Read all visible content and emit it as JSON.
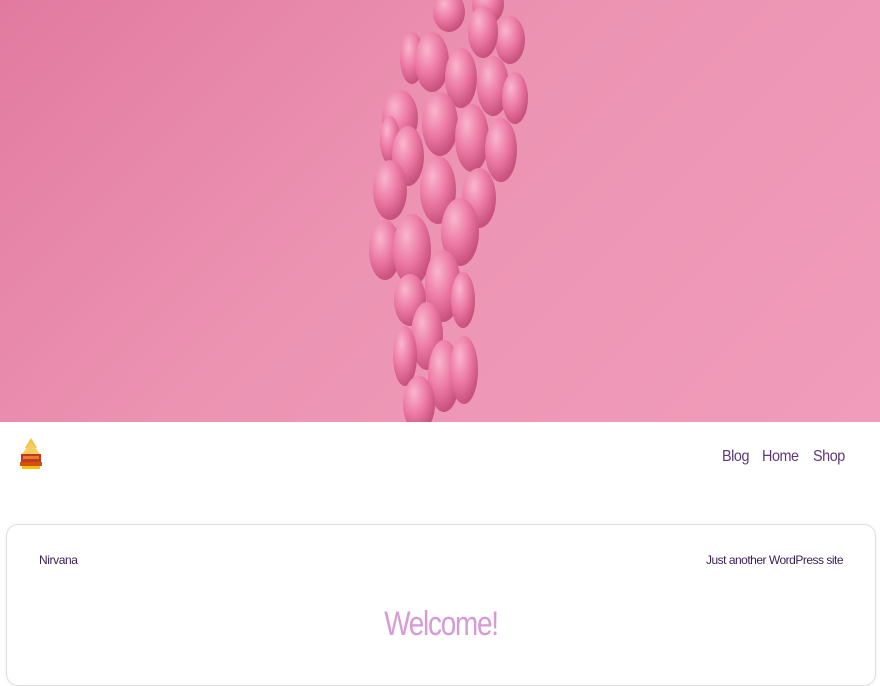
{
  "hero": {
    "image_icon": "pink-balloon-bunch"
  },
  "header": {
    "logo_icon": "pagoda-logo-icon",
    "nav": [
      {
        "label": "Blog"
      },
      {
        "label": "Home"
      },
      {
        "label": "Shop"
      }
    ]
  },
  "main": {
    "site_name": "Nirvana",
    "tagline": "Just another WordPress site",
    "welcome": "Welcome!"
  },
  "colors": {
    "hero_bg": "#ec93b2",
    "nav_text": "#5b3a7a",
    "welcome_text": "#d69ad6"
  }
}
